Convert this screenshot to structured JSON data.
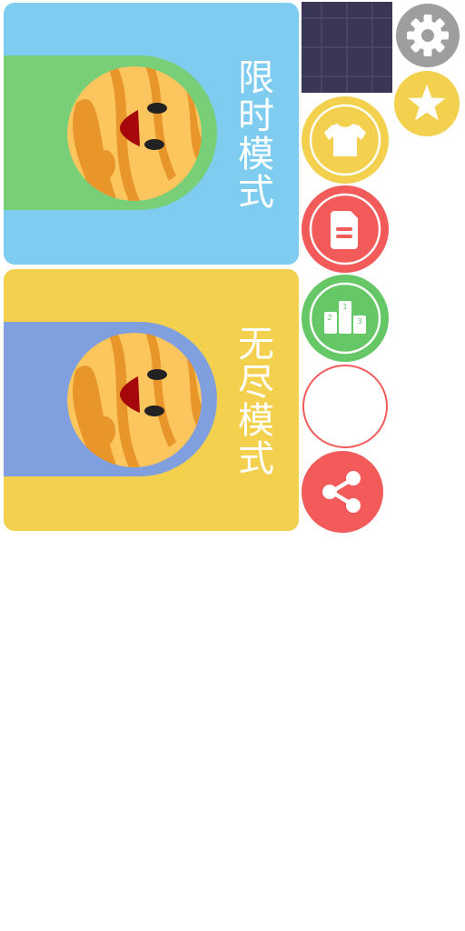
{
  "modes": [
    {
      "label": "限时模式",
      "card_color": "#7ecdf0",
      "band_color": "#78cf78"
    },
    {
      "label": "无尽模式",
      "card_color": "#f3d14f",
      "band_color": "#7f9fdf"
    }
  ],
  "podium": {
    "first": "1",
    "second": "2",
    "third": "3"
  },
  "colors": {
    "settings": "#9e9e9e",
    "star": "#f3d14f",
    "skin": "#f3d14f",
    "notes": "#f35a5a",
    "rank": "#66c766",
    "empty_ring": "#f35a5a",
    "share": "#f35a5a",
    "grid_tile": "#3a3756"
  },
  "icons": [
    "gear-icon",
    "star-icon",
    "shirt-icon",
    "document-icon",
    "podium-icon",
    "share-icon"
  ]
}
